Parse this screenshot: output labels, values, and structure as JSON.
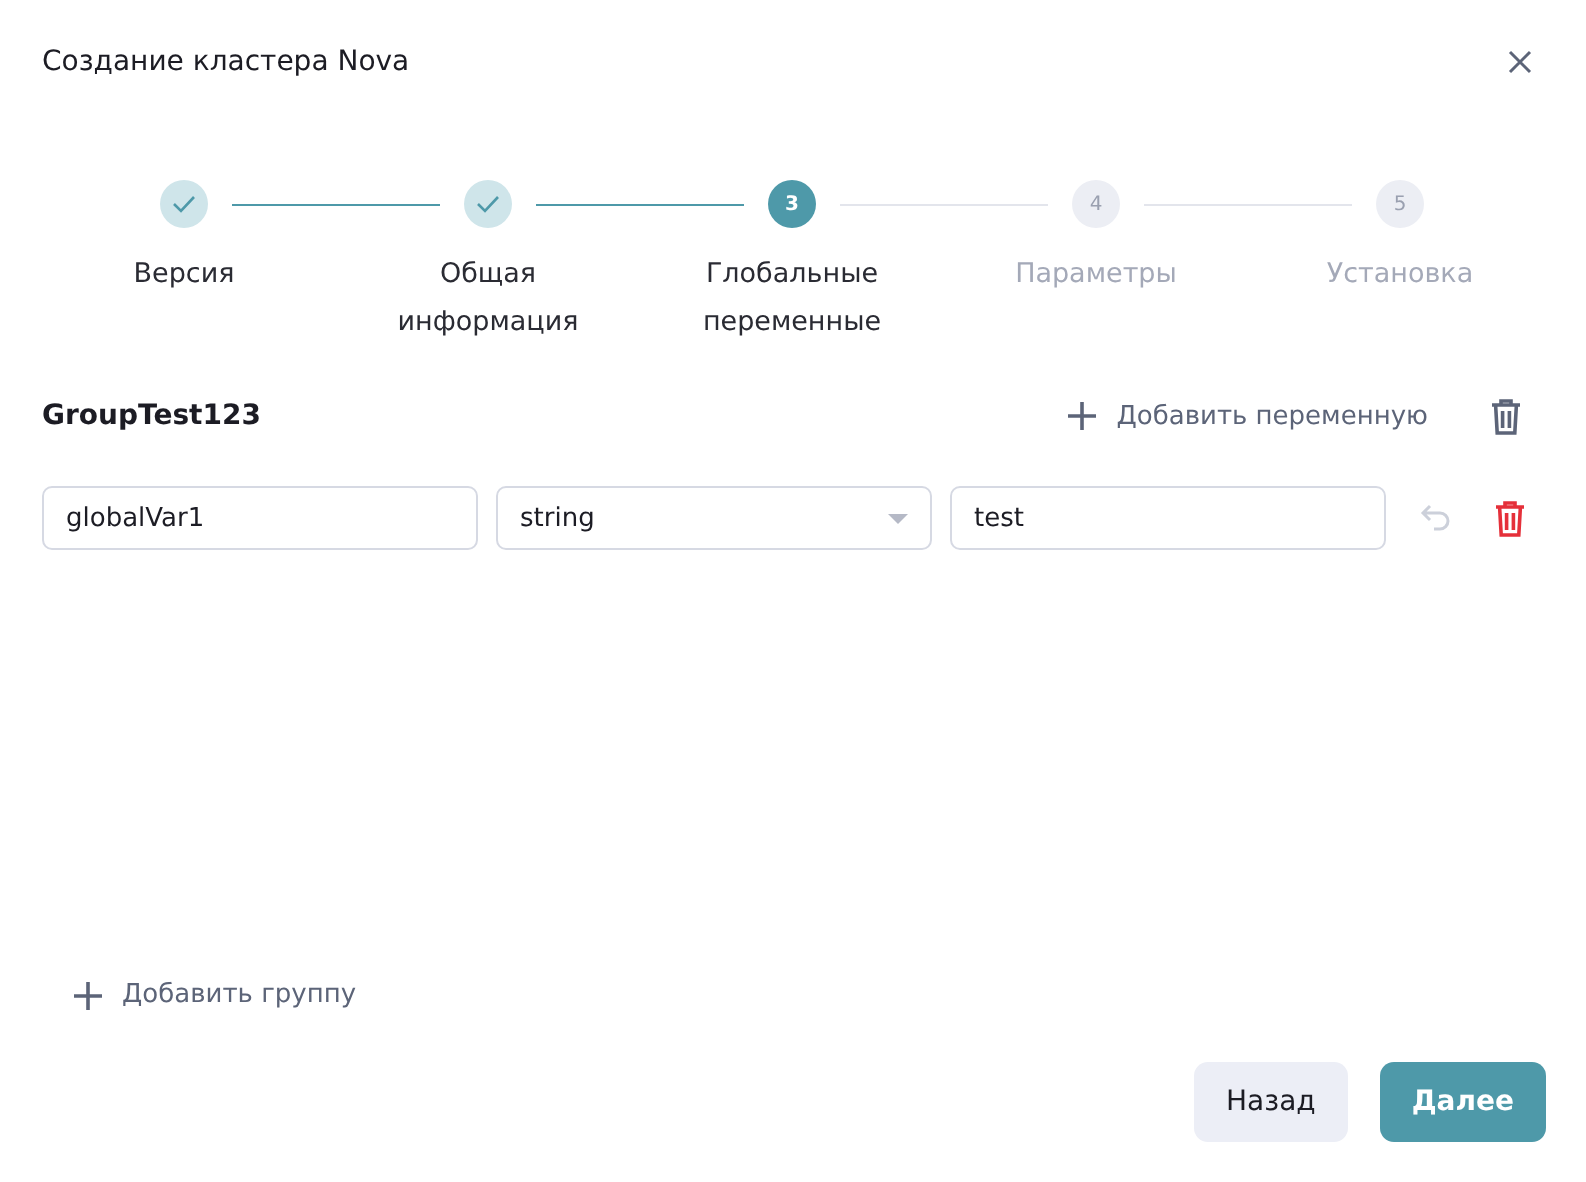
{
  "dialog": {
    "title": "Создание кластера Nova"
  },
  "steps": [
    {
      "label": "Версия",
      "kind": "done"
    },
    {
      "label": "Общая информация",
      "kind": "done"
    },
    {
      "number": "3",
      "label": "Глобальные переменные",
      "kind": "active"
    },
    {
      "number": "4",
      "label": "Параметры",
      "kind": "pending"
    },
    {
      "number": "5",
      "label": "Установка",
      "kind": "pending"
    }
  ],
  "group": {
    "name": "GroupTest123",
    "add_variable": "Добавить переменную",
    "variables": [
      {
        "name": "globalVar1",
        "type": "string",
        "value": "test",
        "undo_disabled": true
      }
    ]
  },
  "add_group": "Добавить группу",
  "buttons": [
    {
      "label": "Назад",
      "kind": "secondary"
    },
    {
      "label": "Далее",
      "kind": "primary"
    }
  ]
}
